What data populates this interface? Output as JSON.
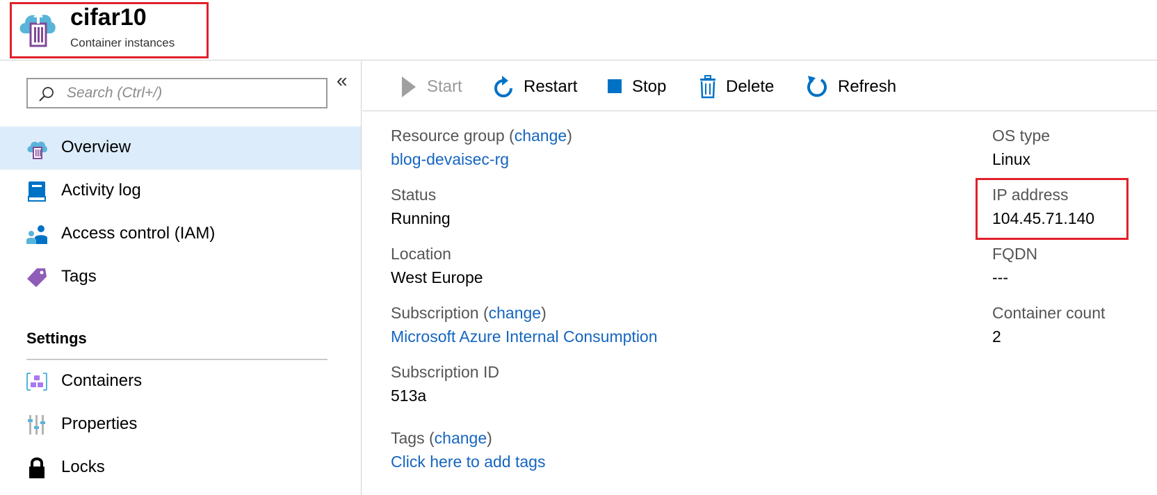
{
  "header": {
    "title": "cifar10",
    "subtitle": "Container instances"
  },
  "sidebar": {
    "search_placeholder": "Search (Ctrl+/)",
    "collapse_glyph": "«",
    "items": [
      {
        "label": "Overview",
        "icon": "container-instance-icon"
      },
      {
        "label": "Activity log",
        "icon": "activity-log-icon"
      },
      {
        "label": "Access control (IAM)",
        "icon": "iam-icon"
      },
      {
        "label": "Tags",
        "icon": "tag-icon"
      }
    ],
    "settings_title": "Settings",
    "settings_items": [
      {
        "label": "Containers",
        "icon": "containers-icon"
      },
      {
        "label": "Properties",
        "icon": "properties-icon"
      },
      {
        "label": "Locks",
        "icon": "lock-icon"
      }
    ]
  },
  "toolbar": {
    "start": "Start",
    "restart": "Restart",
    "stop": "Stop",
    "delete": "Delete",
    "refresh": "Refresh"
  },
  "essentials": {
    "resource_group_label": "Resource group",
    "change": "change",
    "resource_group_value": "blog-devaisec-rg",
    "status_label": "Status",
    "status_value": "Running",
    "location_label": "Location",
    "location_value": "West Europe",
    "subscription_label": "Subscription",
    "subscription_value": "Microsoft Azure Internal Consumption",
    "subscription_id_label": "Subscription ID",
    "subscription_id_value": "513a",
    "tags_label": "Tags",
    "tags_value": "Click here to add tags",
    "os_type_label": "OS type",
    "os_type_value": "Linux",
    "ip_label": "IP address",
    "ip_value": "104.45.71.140",
    "fqdn_label": "FQDN",
    "fqdn_value": "---",
    "container_count_label": "Container count",
    "container_count_value": "2"
  },
  "colors": {
    "accent": "#1565c0",
    "highlight_border": "#e0202a",
    "active_nav": "#dcecfb"
  }
}
